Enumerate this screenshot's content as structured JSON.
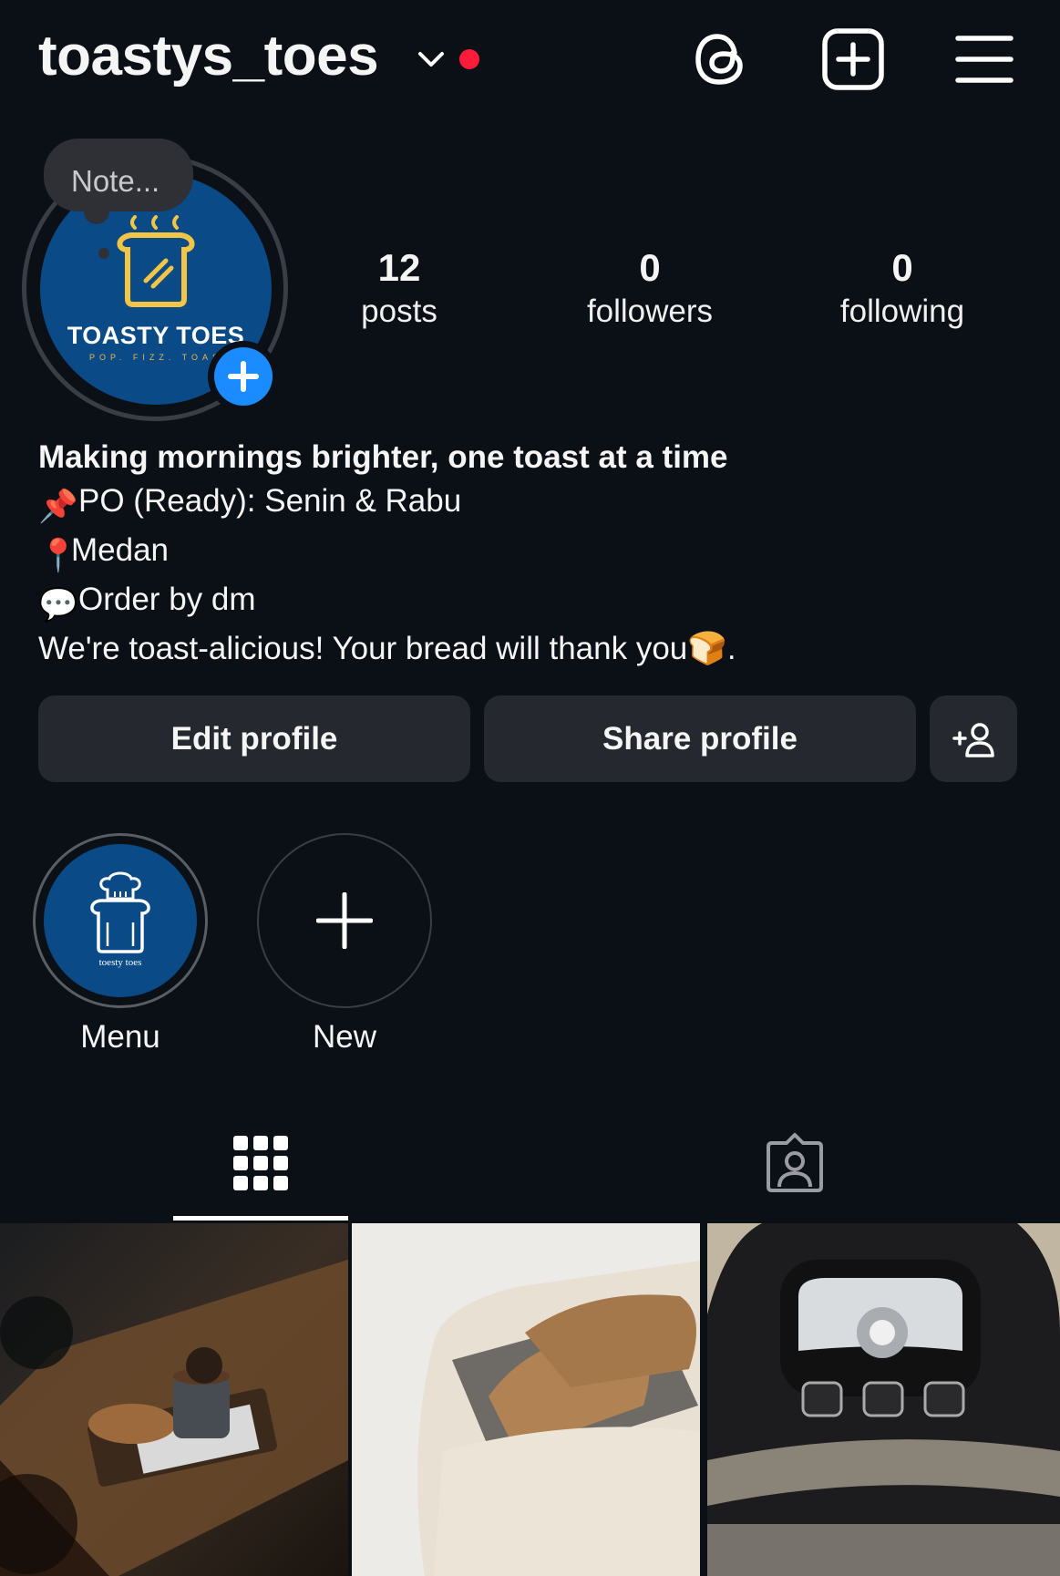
{
  "header": {
    "username": "toastys_toes",
    "icons": [
      "chevron-down-icon",
      "threads-icon",
      "create-post-icon",
      "menu-icon"
    ]
  },
  "profile": {
    "note_placeholder": "Note...",
    "avatar_brand": "TOASTY TOES",
    "avatar_tagline": "POP. FIZZ. TOAS"
  },
  "stats": {
    "posts": {
      "count": "12",
      "label": "posts"
    },
    "followers": {
      "count": "0",
      "label": "followers"
    },
    "following": {
      "count": "0",
      "label": "following"
    }
  },
  "bio": {
    "name": "Making mornings brighter, one toast at a time",
    "line1": "PO (Ready): Senin & Rabu",
    "line2": "Medan",
    "line3": "Order by dm",
    "line4": "We're toast-alicious! Your bread will thank you",
    "line4_end": ".",
    "emoji1": "📌",
    "emoji2": "📍",
    "emoji3": "💬",
    "emoji4": "🍞"
  },
  "buttons": {
    "edit": "Edit profile",
    "share": "Share profile"
  },
  "highlights": [
    {
      "label": "Menu",
      "cover_text": "toesty toes"
    },
    {
      "label": "New"
    }
  ],
  "colors": {
    "background": "#0b0f16",
    "button": "#25282e",
    "accent_blue": "#1a8cff",
    "notification_dot": "#ff1b3a",
    "brand_blue": "#0a4a86",
    "brand_yellow": "#f3c544"
  }
}
